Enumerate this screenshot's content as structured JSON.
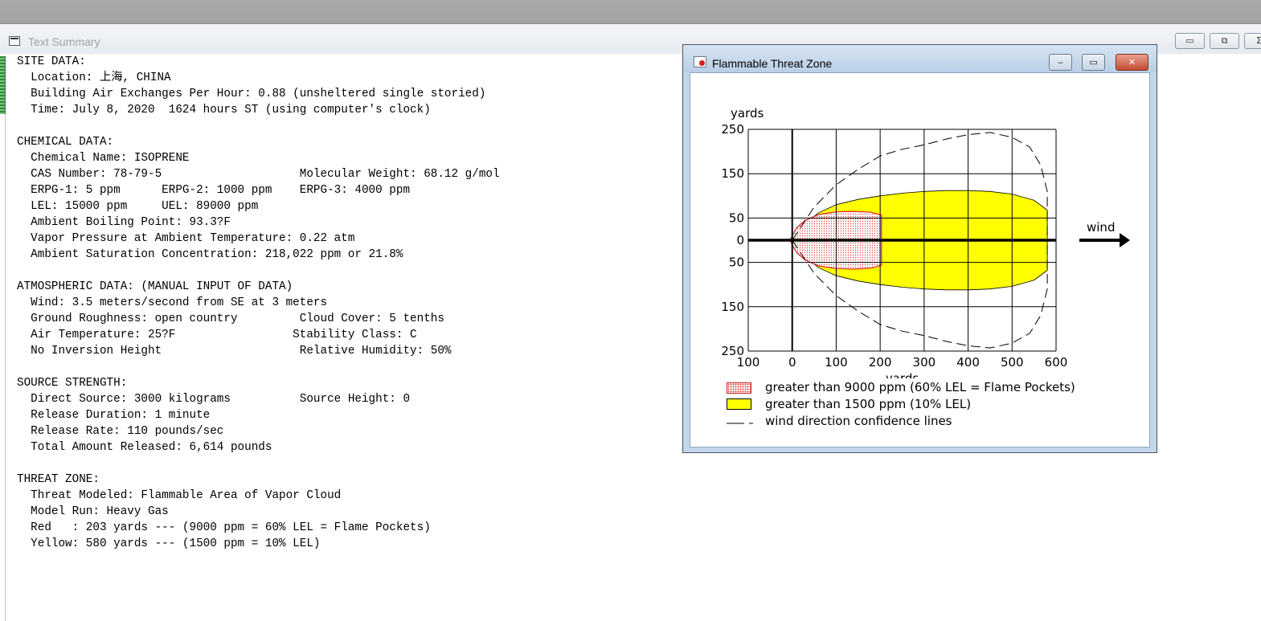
{
  "main_window": {
    "title": "Text Summary",
    "controls": {
      "minimize": "▭",
      "maximize": "⧉",
      "close": "Σ"
    }
  },
  "summary_lines": [
    "SITE DATA:",
    "  Location: 上海, CHINA",
    "  Building Air Exchanges Per Hour: 0.88 (unsheltered single storied)",
    "  Time: July 8, 2020  1624 hours ST (using computer's clock)",
    "",
    "CHEMICAL DATA:",
    "  Chemical Name: ISOPRENE",
    "  CAS Number: 78-79-5                    Molecular Weight: 68.12 g/mol",
    "  ERPG-1: 5 ppm      ERPG-2: 1000 ppm    ERPG-3: 4000 ppm",
    "  LEL: 15000 ppm     UEL: 89000 ppm",
    "  Ambient Boiling Point: 93.3?F",
    "  Vapor Pressure at Ambient Temperature: 0.22 atm",
    "  Ambient Saturation Concentration: 218,022 ppm or 21.8%",
    "",
    "ATMOSPHERIC DATA: (MANUAL INPUT OF DATA)",
    "  Wind: 3.5 meters/second from SE at 3 meters",
    "  Ground Roughness: open country         Cloud Cover: 5 tenths",
    "  Air Temperature: 25?F                 Stability Class: C",
    "  No Inversion Height                    Relative Humidity: 50%",
    "",
    "SOURCE STRENGTH:",
    "  Direct Source: 3000 kilograms          Source Height: 0",
    "  Release Duration: 1 minute",
    "  Release Rate: 110 pounds/sec",
    "  Total Amount Released: 6,614 pounds",
    "",
    "THREAT ZONE:",
    "  Threat Modeled: Flammable Area of Vapor Cloud",
    "  Model Run: Heavy Gas",
    "  Red   : 203 yards --- (9000 ppm = 60% LEL = Flame Pockets)",
    "  Yellow: 580 yards --- (1500 ppm = 10% LEL)"
  ],
  "threat_window": {
    "title": "Flammable Threat Zone",
    "controls": {
      "minimize": "‒",
      "maximize": "▭",
      "close": "✕"
    },
    "wind_label": "wind",
    "legend": [
      {
        "label": "greater than 9000 ppm (60% LEL = Flame Pockets)",
        "swatch": "red-dotted"
      },
      {
        "label": "greater than 1500 ppm (10% LEL)",
        "swatch": "yellow"
      },
      {
        "label": "wind direction confidence lines",
        "swatch": "dashed-line"
      }
    ]
  },
  "chart_data": {
    "type": "area",
    "xlabel": "yards",
    "ylabel": "yards",
    "xlim": [
      -100,
      600
    ],
    "ylim": [
      -250,
      250
    ],
    "x_ticks": [
      -100,
      0,
      100,
      200,
      300,
      400,
      500,
      600
    ],
    "x_tick_labels": [
      "100",
      "0",
      "100",
      "200",
      "300",
      "400",
      "500",
      "600"
    ],
    "y_ticks": [
      250,
      150,
      50,
      0,
      -50,
      -150,
      -250
    ],
    "y_tick_labels": [
      "250",
      "150",
      "50",
      "0",
      "50",
      "150",
      "250"
    ],
    "grid": true,
    "colors": {
      "red_zone": "#e02020",
      "yellow_zone": "#ffff00"
    },
    "series": [
      {
        "name": "greater than 1500 ppm (10% LEL)",
        "color": "#ffff00",
        "x": [
          0,
          10,
          30,
          60,
          100,
          150,
          200,
          250,
          300,
          350,
          400,
          450,
          500,
          550,
          580,
          580
        ],
        "y": [
          0,
          14,
          38,
          62,
          80,
          92,
          100,
          106,
          110,
          112,
          112,
          110,
          104,
          90,
          68,
          0
        ]
      },
      {
        "name": "greater than 9000 ppm (60% LEL = Flame Pockets)",
        "color": "#e02020",
        "x": [
          -5,
          0,
          10,
          30,
          60,
          100,
          140,
          180,
          203,
          203
        ],
        "y": [
          0,
          10,
          28,
          45,
          58,
          64,
          65,
          63,
          56,
          0
        ]
      },
      {
        "name": "wind direction confidence lines",
        "x": [
          0,
          20,
          50,
          100,
          150,
          200,
          250,
          300,
          350,
          400,
          450,
          500,
          540,
          565,
          580,
          580
        ],
        "y": [
          0,
          30,
          75,
          125,
          160,
          190,
          205,
          215,
          228,
          238,
          243,
          232,
          210,
          170,
          110,
          0
        ]
      }
    ]
  }
}
